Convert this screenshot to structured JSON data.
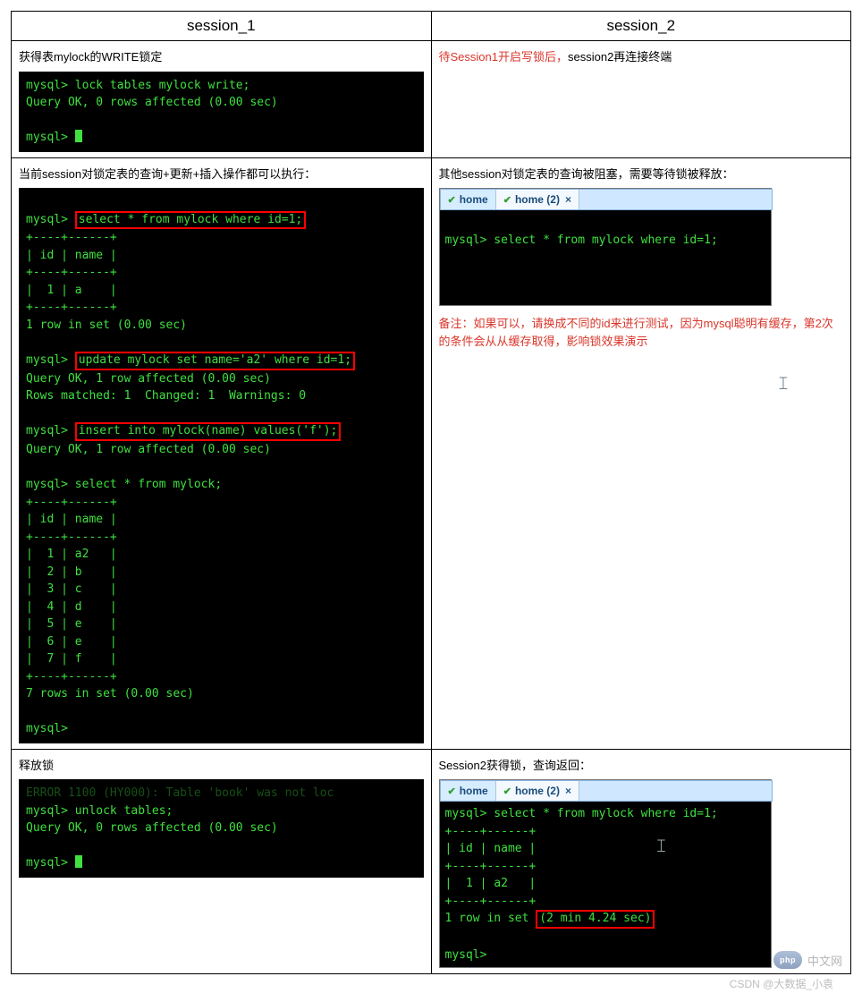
{
  "header": {
    "col1": "session_1",
    "col2": "session_2"
  },
  "row1": {
    "left": {
      "desc": "获得表mylock的WRITE锁定",
      "t1": "mysql> lock tables mylock write;",
      "t2": "Query OK, 0 rows affected (0.00 sec)",
      "t3": "mysql> "
    },
    "right": {
      "desc_a": "待Session1开启写锁后，",
      "desc_b": "session2再连接终端"
    }
  },
  "row2": {
    "left": {
      "desc": "当前session对锁定表的查询+更新+插入操作都可以执行：",
      "p0": "mysql> ",
      "hl1": "select * from mylock where id=1;",
      "tbl1a": "+----+------+",
      "tbl1b": "| id | name |",
      "tbl1c": "+----+------+",
      "tbl1d": "|  1 | a    |",
      "tbl1e": "+----+------+",
      "res1": "1 row in set (0.00 sec)",
      "p1": "mysql> ",
      "hl2": "update mylock set name='a2' where id=1;",
      "upd1": "Query OK, 1 row affected (0.00 sec)",
      "upd2": "Rows matched: 1  Changed: 1  Warnings: 0",
      "p2": "mysql> ",
      "hl3": "insert into mylock(name) values('f');",
      "ins1": "Query OK, 1 row affected (0.00 sec)",
      "p3": "mysql> select * from mylock;",
      "t2a": "+----+------+",
      "t2b": "| id | name |",
      "t2c": "+----+------+",
      "r1": "|  1 | a2   |",
      "r2": "|  2 | b    |",
      "r3": "|  3 | c    |",
      "r4": "|  4 | d    |",
      "r5": "|  5 | e    |",
      "r6": "|  6 | e    |",
      "r7": "|  7 | f    |",
      "t2d": "+----+------+",
      "res2": "7 rows in set (0.00 sec)",
      "p4": "mysql>"
    },
    "right": {
      "desc": "其他session对锁定表的查询被阻塞，需要等待锁被释放：",
      "tab1": "home",
      "tab2": "home (2)",
      "tline": "mysql> select * from mylock where id=1;",
      "note": "备注：如果可以，请换成不同的id来进行测试，因为mysql聪明有缓存，第2次的条件会从从缓存取得，影响锁效果演示"
    }
  },
  "row3": {
    "left": {
      "desc": "释放锁",
      "e1": "ERROR 1100 (HY000): Table 'book' was not loc",
      "t1": "mysql> unlock tables;",
      "t2": "Query OK, 0 rows affected (0.00 sec)",
      "t3": "mysql> "
    },
    "right": {
      "desc": "Session2获得锁，查询返回：",
      "tab1": "home",
      "tab2": "home (2)",
      "l1": "mysql> select * from mylock where id=1;",
      "l2": "+----+------+",
      "l3": "| id | name |",
      "l4": "+----+------+",
      "l5": "|  1 | a2   |",
      "l6": "+----+------+",
      "l7a": "1 row in set ",
      "l7b": "(2 min 4.24 sec)",
      "l8": "mysql>"
    }
  },
  "footer": {
    "php": "php",
    "cn": "中文网",
    "credit": "CSDN @大数据_小袁"
  }
}
